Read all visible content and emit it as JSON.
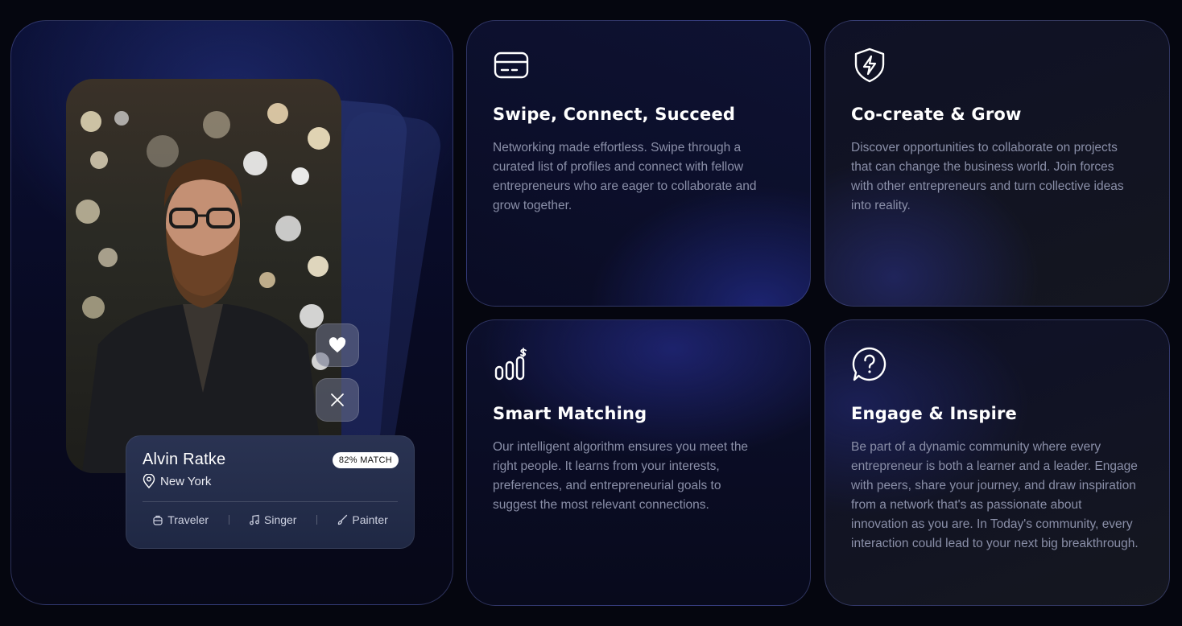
{
  "profile": {
    "name": "Alvin Ratke",
    "match": "82% MATCH",
    "location": "New York",
    "tags": [
      {
        "label": "Traveler",
        "icon": "backpack-icon"
      },
      {
        "label": "Singer",
        "icon": "music-note-icon"
      },
      {
        "label": "Painter",
        "icon": "brush-icon"
      }
    ],
    "actions": {
      "like_icon": "heart-icon",
      "pass_icon": "close-icon"
    }
  },
  "features": [
    {
      "icon": "credit-card-icon",
      "title": "Swipe, Connect, Succeed",
      "text": "Networking made effortless. Swipe through a curated list of profiles and connect with fellow entrepreneurs who are eager to collaborate and grow together."
    },
    {
      "icon": "shield-bolt-icon",
      "title": "Co-create & Grow",
      "text": "Discover opportunities to collaborate on projects that can change the business world. Join forces with other entrepreneurs and turn collective ideas into reality."
    },
    {
      "icon": "chart-dollar-icon",
      "title": "Smart Matching",
      "text": "Our intelligent algorithm ensures you meet the right people. It learns from your interests, preferences, and entrepreneurial goals to suggest the most relevant connections."
    },
    {
      "icon": "question-bubble-icon",
      "title": "Engage & Inspire",
      "text": "Be part of a dynamic community where every entrepreneur is both a learner and a leader. Engage with peers, share your journey, and draw inspiration from a network that's as passionate about innovation as you are. In Today's community, every interaction could lead to your next big breakthrough."
    }
  ]
}
